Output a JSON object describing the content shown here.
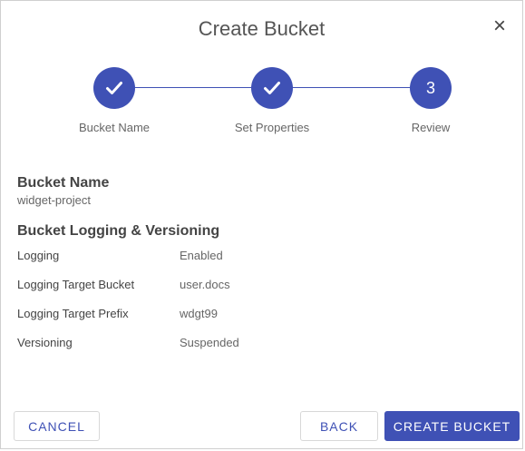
{
  "dialog": {
    "title": "Create Bucket",
    "close_icon": "×"
  },
  "stepper": {
    "steps": [
      {
        "label": "Bucket Name",
        "state": "complete",
        "indicator": "check-icon"
      },
      {
        "label": "Set Properties",
        "state": "complete",
        "indicator": "check-icon"
      },
      {
        "label": "Review",
        "state": "active",
        "indicator": "3"
      }
    ],
    "accent_color": "#3f51b5"
  },
  "summary": {
    "bucket_name_heading": "Bucket Name",
    "bucket_name_value": "widget-project",
    "logging_heading": "Bucket Logging & Versioning",
    "rows": [
      {
        "label": "Logging",
        "value": "Enabled"
      },
      {
        "label": "Logging Target Bucket",
        "value": "user.docs"
      },
      {
        "label": "Logging Target Prefix",
        "value": "wdgt99"
      },
      {
        "label": "Versioning",
        "value": "Suspended"
      }
    ]
  },
  "footer": {
    "cancel_label": "CANCEL",
    "back_label": "BACK",
    "create_label": "CREATE BUCKET"
  }
}
